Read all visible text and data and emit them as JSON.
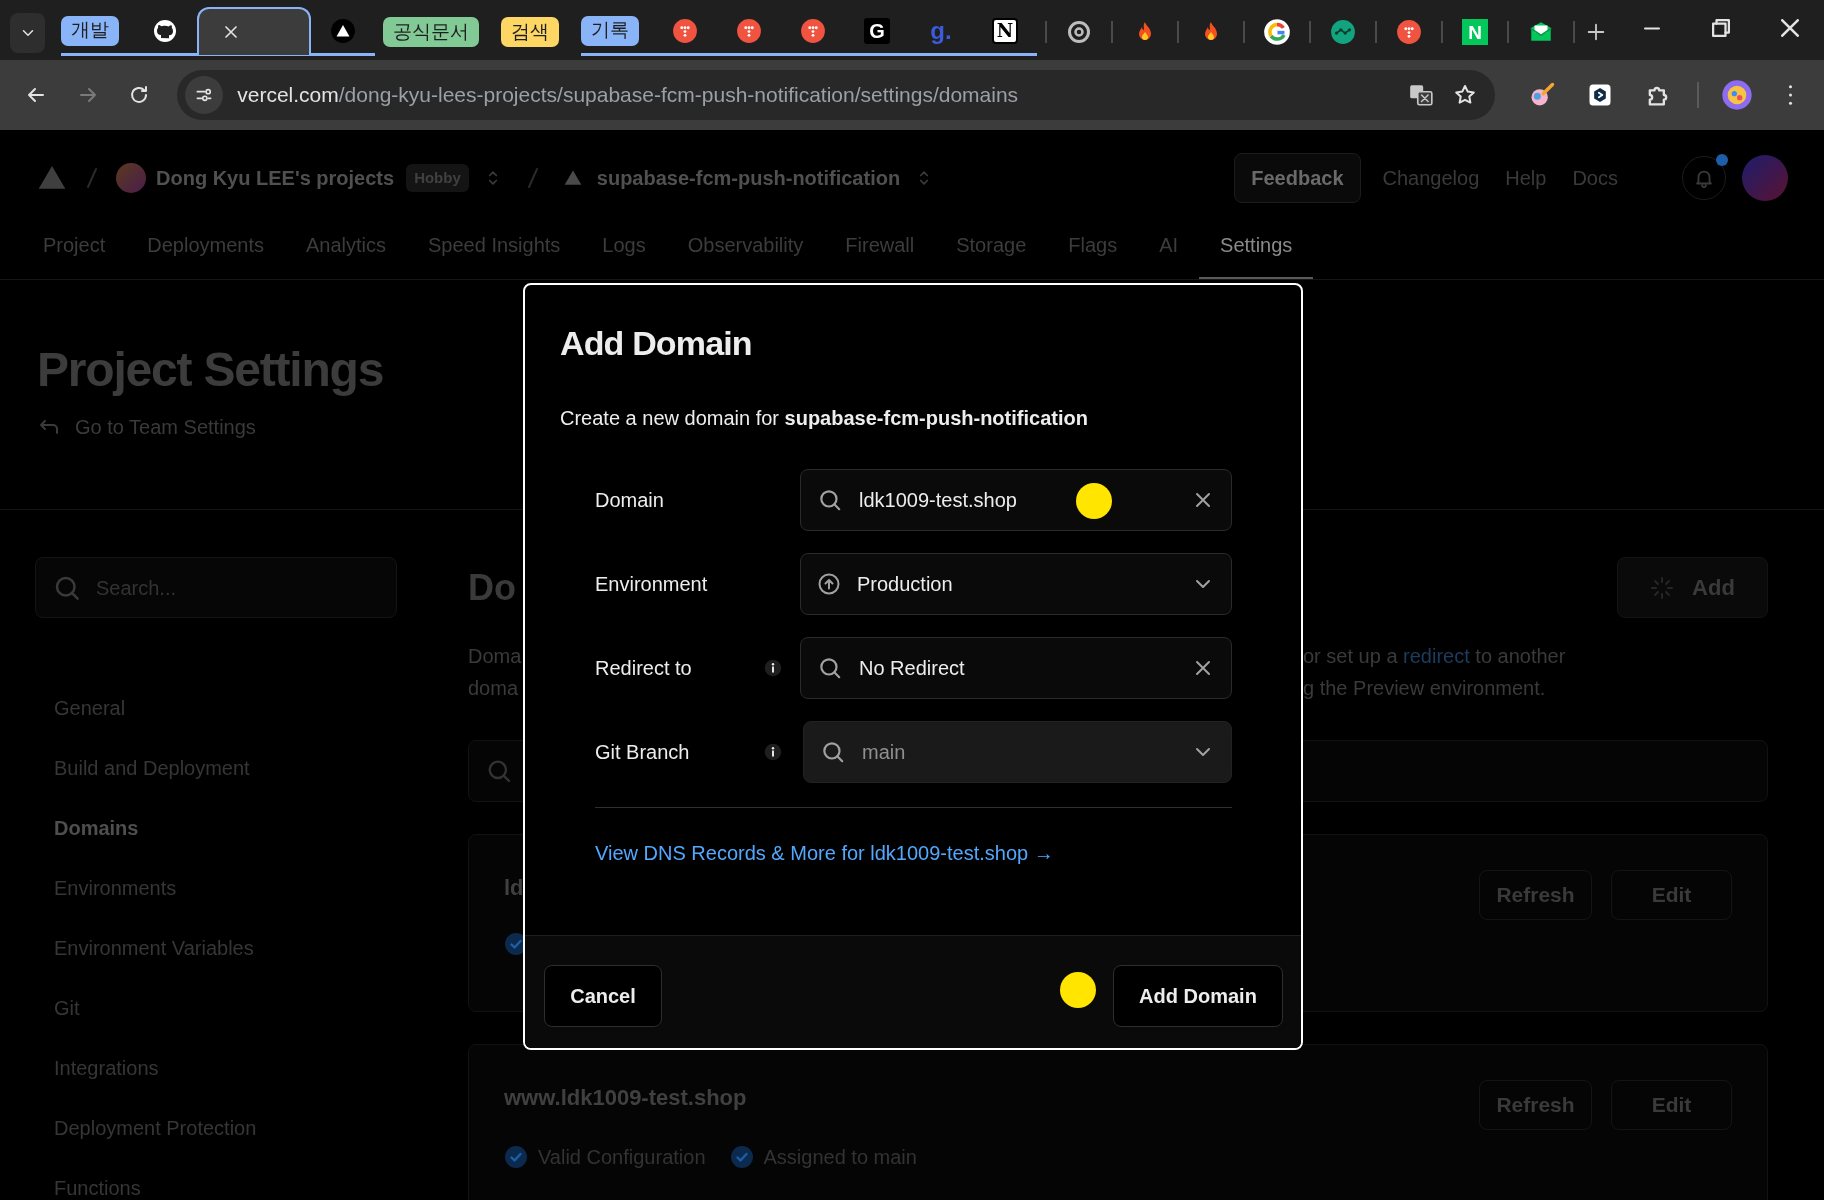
{
  "browser": {
    "tab_strip": [
      {
        "kind": "group",
        "label": "개발",
        "color": "#8ab4f8",
        "tabs": [
          {
            "kind": "cat",
            "selected": false
          },
          {
            "kind": "close",
            "selected": true
          },
          {
            "kind": "triangle",
            "selected": false
          }
        ]
      },
      {
        "kind": "group",
        "label": "공식문서",
        "color": "#81c995"
      },
      {
        "kind": "group",
        "label": "검색",
        "color": "#fdd663"
      },
      {
        "kind": "group",
        "label": "기록",
        "color": "#8ab4f8",
        "tabs": [
          {
            "kind": "dots",
            "selected": false
          },
          {
            "kind": "dots",
            "selected": false
          },
          {
            "kind": "dots",
            "selected": false
          },
          {
            "kind": "tile-dark",
            "glyph": "G",
            "selected": false
          },
          {
            "kind": "text-blue",
            "glyph": "g.",
            "selected": false
          },
          {
            "kind": "tile-light",
            "glyph": "N",
            "selected": false
          }
        ]
      },
      {
        "kind": "ring",
        "selected": false
      },
      {
        "kind": "flame",
        "selected": false
      },
      {
        "kind": "flame",
        "selected": false
      },
      {
        "kind": "multi-ring",
        "selected": false
      },
      {
        "kind": "network",
        "selected": false
      },
      {
        "kind": "dots",
        "selected": false
      },
      {
        "kind": "tile-green",
        "glyph": "N",
        "selected": false
      },
      {
        "kind": "mail",
        "selected": false
      }
    ],
    "address_bar": {
      "url": "vercel.com/dong-kyu-lees-projects/supabase-fcm-push-notification/settings/domains"
    }
  },
  "header": {
    "team": "Dong Kyu LEE's projects",
    "plan_badge": "Hobby",
    "project": "supabase-fcm-push-notification",
    "feedback_button": "Feedback",
    "links": [
      "Changelog",
      "Help",
      "Docs"
    ],
    "unread_notifications": true
  },
  "nav_tabs": [
    {
      "label": "Project",
      "selected": false
    },
    {
      "label": "Deployments",
      "selected": false
    },
    {
      "label": "Analytics",
      "selected": false
    },
    {
      "label": "Speed Insights",
      "selected": false
    },
    {
      "label": "Logs",
      "selected": false
    },
    {
      "label": "Observability",
      "selected": false
    },
    {
      "label": "Firewall",
      "selected": false
    },
    {
      "label": "Storage",
      "selected": false
    },
    {
      "label": "Flags",
      "selected": false
    },
    {
      "label": "AI",
      "selected": false
    },
    {
      "label": "Settings",
      "selected": true
    }
  ],
  "page": {
    "title": "Project Settings",
    "back_link": "Go to Team Settings"
  },
  "sidebar": {
    "search": {
      "placeholder": "Search..."
    },
    "items": [
      {
        "label": "General",
        "selected": false
      },
      {
        "label": "Build and Deployment",
        "selected": false
      },
      {
        "label": "Domains",
        "selected": true
      },
      {
        "label": "Environments",
        "selected": false
      },
      {
        "label": "Environment Variables",
        "selected": false
      },
      {
        "label": "Git",
        "selected": false
      },
      {
        "label": "Integrations",
        "selected": false
      },
      {
        "label": "Deployment Protection",
        "selected": false
      },
      {
        "label": "Functions",
        "selected": false
      }
    ]
  },
  "main": {
    "heading": "Do",
    "add_button": "Add",
    "description": [
      {
        "left": "Doma",
        "before": "or set up a",
        "link": "redirect",
        "after": "to another"
      },
      {
        "left": "doma",
        "before": "g the Preview environment."
      }
    ],
    "domains": [
      {
        "name": "ld",
        "statuses": [
          {
            "verified": true
          }
        ],
        "buttons": [
          "Refresh",
          "Edit"
        ]
      },
      {
        "name": "www.ldk1009-test.shop",
        "statuses": [
          {
            "verified": true,
            "label": "Valid Configuration"
          },
          {
            "verified": true,
            "label": "Assigned to main"
          }
        ],
        "buttons": [
          "Refresh",
          "Edit"
        ]
      }
    ]
  },
  "modal": {
    "title": "Add Domain",
    "subtitle": "Create a new domain for **supabase-fcm-push-notification**",
    "fields": [
      {
        "kind": "search",
        "label": "Domain",
        "value": "ldk1009-test.shop",
        "clearable": true,
        "info": false
      },
      {
        "kind": "select",
        "label": "Environment",
        "value": "Production",
        "info": false
      },
      {
        "kind": "search",
        "label": "Redirect to",
        "value": "No Redirect",
        "clearable": true,
        "info": true
      },
      {
        "kind": "combo",
        "label": "Git Branch",
        "placeholder": "main",
        "info": true
      }
    ],
    "link": "View DNS Records & More for ldk1009-test.shop →",
    "buttons": [
      {
        "label": "Cancel"
      },
      {
        "label": "Add Domain"
      }
    ]
  }
}
